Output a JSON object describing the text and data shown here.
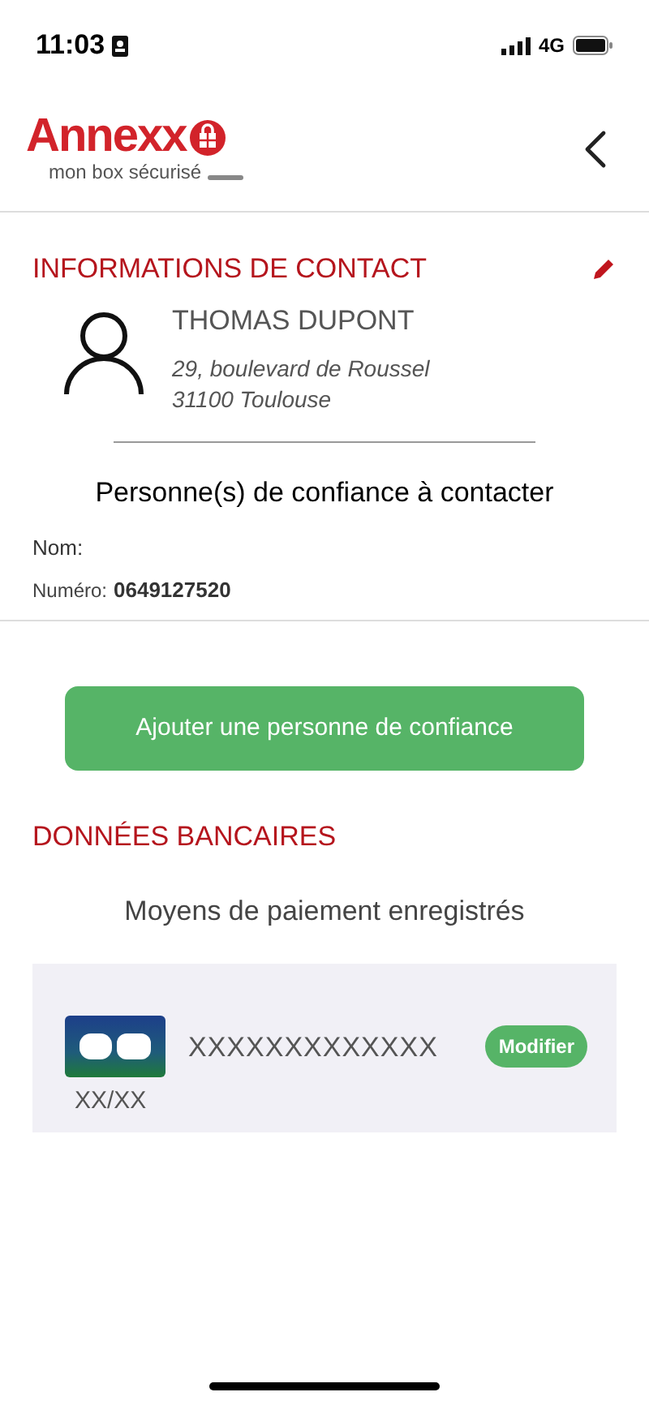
{
  "status_bar": {
    "time": "11:03",
    "network": "4G"
  },
  "header": {
    "logo_title": "Annexx",
    "logo_tagline": "mon box sécurisé"
  },
  "contact": {
    "heading": "INFORMATIONS DE CONTACT",
    "name": "THOMAS DUPONT",
    "address_line_1": "29, boulevard de Roussel",
    "address_line_2": "31100 Toulouse"
  },
  "trusted": {
    "heading": "Personne(s) de confiance à contacter",
    "name_label": "Nom:",
    "number_label": "Numéro:",
    "number": "0649127520"
  },
  "add_button": "Ajouter une personne de confiance",
  "bank": {
    "heading": "DONNÉES BANCAIRES",
    "subheading": "Moyens de paiement enregistrés",
    "card_number": "XXXXXXXXXXXXX",
    "expiry": "XX/XX",
    "edit_button": "Modifier"
  }
}
